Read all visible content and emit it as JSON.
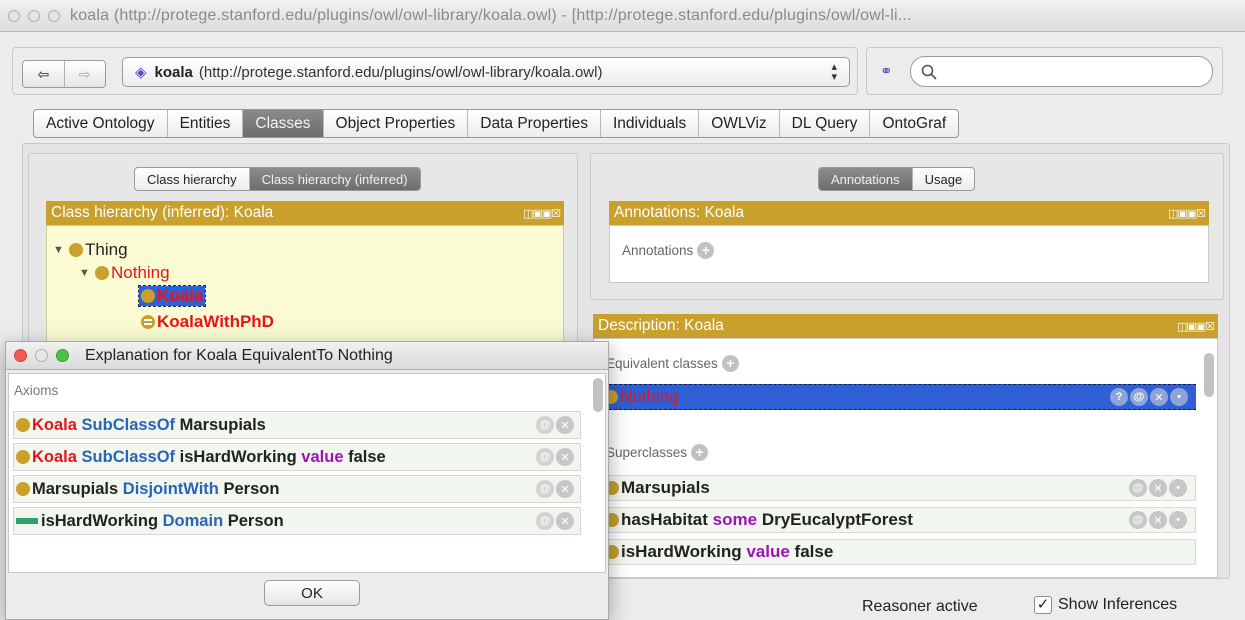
{
  "window": {
    "title": "koala (http://protege.stanford.edu/plugins/owl/owl-library/koala.owl) - [http://protege.stanford.edu/plugins/owl/owl-li..."
  },
  "toolbar": {
    "back_glyph": "⇦",
    "forward_glyph": "⇨",
    "ontology_name": "koala",
    "ontology_uri": "(http://protege.stanford.edu/plugins/owl/owl-library/koala.owl)",
    "search_placeholder": ""
  },
  "tabs": [
    {
      "label": "Active Ontology",
      "active": false
    },
    {
      "label": "Entities",
      "active": false
    },
    {
      "label": "Classes",
      "active": true
    },
    {
      "label": "Object Properties",
      "active": false
    },
    {
      "label": "Data Properties",
      "active": false
    },
    {
      "label": "Individuals",
      "active": false
    },
    {
      "label": "OWLViz",
      "active": false
    },
    {
      "label": "DL Query",
      "active": false
    },
    {
      "label": "OntoGraf",
      "active": false
    }
  ],
  "left_panel": {
    "seg_a": "Class hierarchy",
    "seg_b": "Class hierarchy (inferred)",
    "header": "Class hierarchy (inferred): Koala",
    "tree": {
      "thing": "Thing",
      "nothing": "Nothing",
      "koala": "Koala",
      "koala_phd": "KoalaWithPhD"
    }
  },
  "right_top": {
    "seg_a": "Annotations",
    "seg_b": "Usage",
    "header": "Annotations: Koala",
    "annotations_label": "Annotations"
  },
  "description": {
    "header": "Description: Koala",
    "equivalent_label": "Equivalent classes",
    "equivalent_item": "Nothing",
    "superclasses_label": "Superclasses",
    "super_1": "Marsupials",
    "super_2_a": "hasHabitat",
    "super_2_b": "some",
    "super_2_c": "DryEucalyptForest",
    "super_3_a": "isHardWorking",
    "super_3_b": "value",
    "super_3_c": "false"
  },
  "dialog": {
    "title": "Explanation for Koala EquivalentTo Nothing",
    "axioms_label": "Axioms",
    "axioms": [
      {
        "a": "Koala",
        "b": "SubClassOf",
        "c": "Marsupials"
      },
      {
        "a": "Koala",
        "b": "SubClassOf",
        "c": "isHardWorking",
        "d": "value",
        "e": "false"
      },
      {
        "a": "Marsupials",
        "b": "DisjointWith",
        "c": "Person"
      },
      {
        "a": "isHardWorking",
        "b": "Domain",
        "c": "Person"
      }
    ],
    "ok_label": "OK"
  },
  "status": {
    "reasoner": "Reasoner active",
    "show_inferences": "Show Inferences",
    "check_glyph": "✓"
  },
  "colors": {
    "accent_gold": "#c9a02c",
    "selection_blue": "#2f5fd4",
    "inconsistent_red": "#e8141a"
  }
}
